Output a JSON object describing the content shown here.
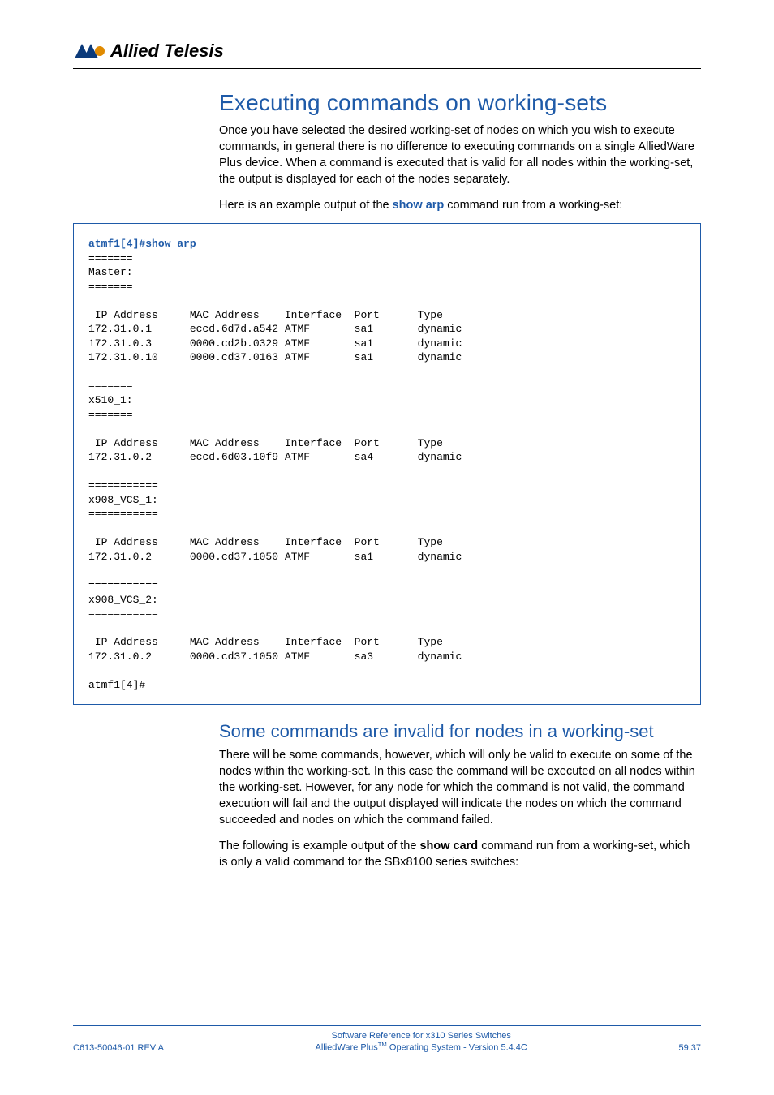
{
  "brand": {
    "name": "Allied Telesis"
  },
  "section": {
    "title": "Executing commands on working-sets",
    "p1": "Once you have selected the desired working-set of nodes on which you wish to execute commands, in general there is no difference to executing commands on a single AlliedWare Plus device. When a command is executed that is valid for all nodes within the working-set, the output is displayed for each of the nodes separately.",
    "p2_pre": "Here is an example output of the ",
    "p2_cmd": "show arp",
    "p2_post": " command run from a working-set:"
  },
  "terminal": {
    "prompt_cmd": "atmf1[4]#show arp",
    "blocks": [
      {
        "sep": "=======",
        "name": "Master:",
        "rows": [
          {
            "ip": "172.31.0.1",
            "mac": "eccd.6d7d.a542",
            "iface": "ATMF",
            "port": "sa1",
            "type": "dynamic"
          },
          {
            "ip": "172.31.0.3",
            "mac": "0000.cd2b.0329",
            "iface": "ATMF",
            "port": "sa1",
            "type": "dynamic"
          },
          {
            "ip": "172.31.0.10",
            "mac": "0000.cd37.0163",
            "iface": "ATMF",
            "port": "sa1",
            "type": "dynamic"
          }
        ]
      },
      {
        "sep": "=======",
        "name": "x510_1:",
        "rows": [
          {
            "ip": "172.31.0.2",
            "mac": "eccd.6d03.10f9",
            "iface": "ATMF",
            "port": "sa4",
            "type": "dynamic"
          }
        ]
      },
      {
        "sep": "===========",
        "name": "x908_VCS_1:",
        "rows": [
          {
            "ip": "172.31.0.2",
            "mac": "0000.cd37.1050",
            "iface": "ATMF",
            "port": "sa1",
            "type": "dynamic"
          }
        ]
      },
      {
        "sep": "===========",
        "name": "x908_VCS_2:",
        "rows": [
          {
            "ip": "172.31.0.2",
            "mac": "0000.cd37.1050",
            "iface": "ATMF",
            "port": "sa3",
            "type": "dynamic"
          }
        ]
      }
    ],
    "header": {
      "ip": "IP Address",
      "mac": "MAC Address",
      "iface": "Interface",
      "port": "Port",
      "type": "Type"
    },
    "end_prompt": "atmf1[4]#"
  },
  "subsection": {
    "title": "Some commands are invalid for nodes in a working-set",
    "p1": "There will be some commands, however, which will only be valid to execute on some of the nodes within the working-set. In this case the command will be executed on all nodes within the working-set. However, for any node for which the command is not valid, the command execution will fail and the output displayed will indicate the nodes on which the command succeeded and nodes on which the command failed.",
    "p2_pre": "The following is example output of the ",
    "p2_bold": "show card",
    "p2_post": " command run from a working-set, which is only a valid command for the SBx8100 series switches:"
  },
  "footer": {
    "left": "C613-50046-01 REV A",
    "center1": "Software Reference for x310 Series Switches",
    "center2_pre": "AlliedWare Plus",
    "center2_tm": "TM",
    "center2_post": " Operating System - Version 5.4.4C",
    "right": "59.37"
  }
}
